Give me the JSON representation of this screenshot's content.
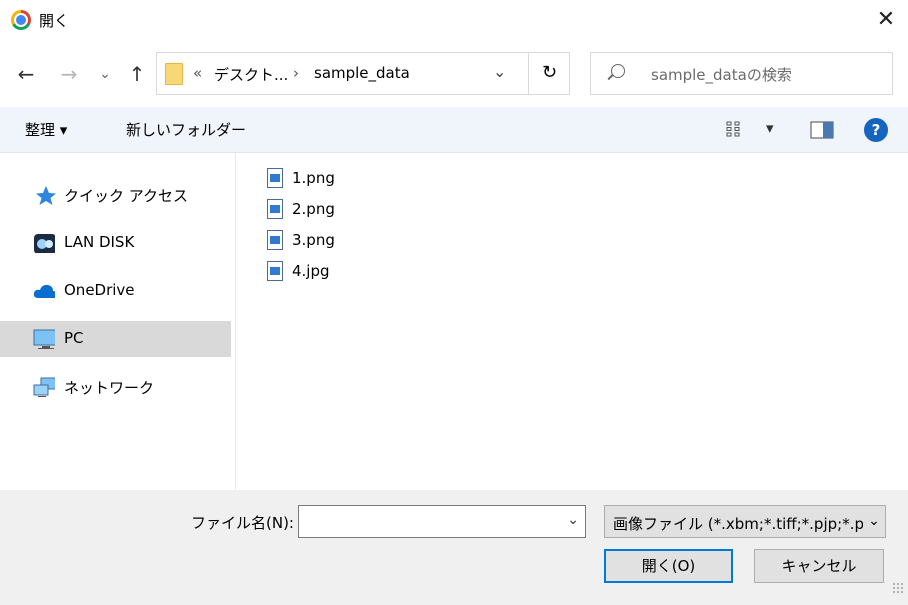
{
  "window": {
    "title": "開く",
    "close_glyph": "✕"
  },
  "nav_buttons": {
    "back": "←",
    "forward": "→",
    "history": "⌄",
    "up": "↑"
  },
  "address": {
    "overflow": "«",
    "crumbs": [
      "デスクト...",
      "sample_data"
    ],
    "separator": "›",
    "dropdown": "⌄",
    "refresh": "↻"
  },
  "search": {
    "placeholder": "sample_dataの検索"
  },
  "toolbar": {
    "organize": "整理 ▾",
    "new_folder": "新しいフォルダー",
    "view": "▾",
    "help": "?"
  },
  "sidebar": {
    "items": [
      {
        "label": "クイック アクセス",
        "icon": "star-icon"
      },
      {
        "label": "LAN DISK",
        "icon": "nas-icon"
      },
      {
        "label": "OneDrive",
        "icon": "cloud-icon"
      },
      {
        "label": "PC",
        "icon": "monitor-icon",
        "selected": true
      },
      {
        "label": "ネットワーク",
        "icon": "network-icon"
      }
    ]
  },
  "files": [
    {
      "name": "1.png"
    },
    {
      "name": "2.png"
    },
    {
      "name": "3.png"
    },
    {
      "name": "4.jpg"
    }
  ],
  "footer": {
    "filename_label": "ファイル名(N):",
    "filename_value": "",
    "filter_value": "画像ファイル (*.xbm;*.tiff;*.pjp;*.pjpeg;*.jpg)",
    "open_label": "開く(O)",
    "cancel_label": "キャンセル"
  },
  "colors": {
    "accent": "#0078d7",
    "toolbar_bg": "#f0f5fb",
    "selected_bg": "#d9d9d9",
    "help": "#1565c0"
  }
}
